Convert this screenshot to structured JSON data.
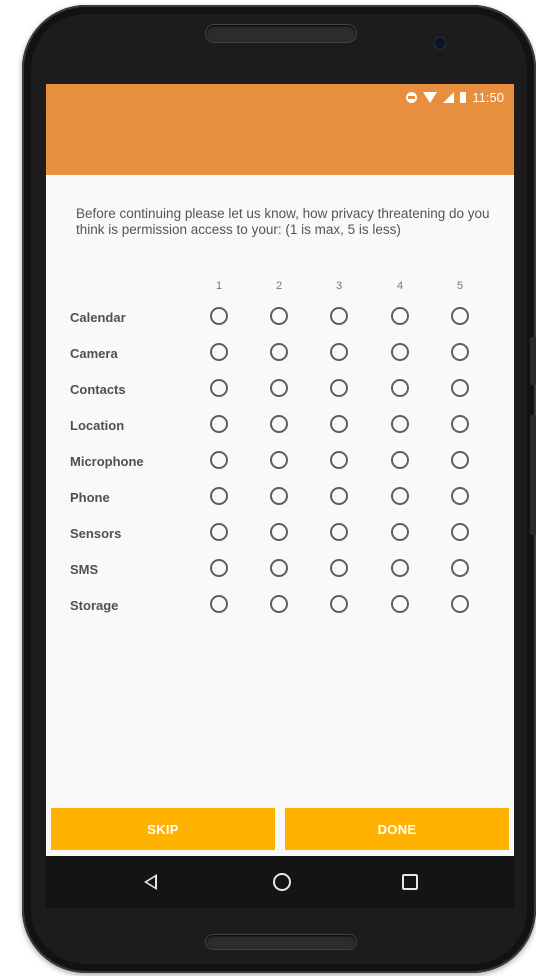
{
  "status_bar": {
    "time": "11:50"
  },
  "question": "Before continuing please let us know, how privacy threatening do you think is permission access to your: (1 is max, 5 is less)",
  "scale": [
    "1",
    "2",
    "3",
    "4",
    "5"
  ],
  "permissions": [
    "Calendar",
    "Camera",
    "Contacts",
    "Location",
    "Microphone",
    "Phone",
    "Sensors",
    "SMS",
    "Storage"
  ],
  "buttons": {
    "skip": "SKIP",
    "done": "DONE"
  },
  "colors": {
    "status_bar": "#e78f3e",
    "app_bar": "#e8913f",
    "button": "#ffb300"
  },
  "nav": {
    "back_icon": "back-triangle-icon",
    "home_icon": "home-circle-icon",
    "recent_icon": "recent-square-icon"
  }
}
